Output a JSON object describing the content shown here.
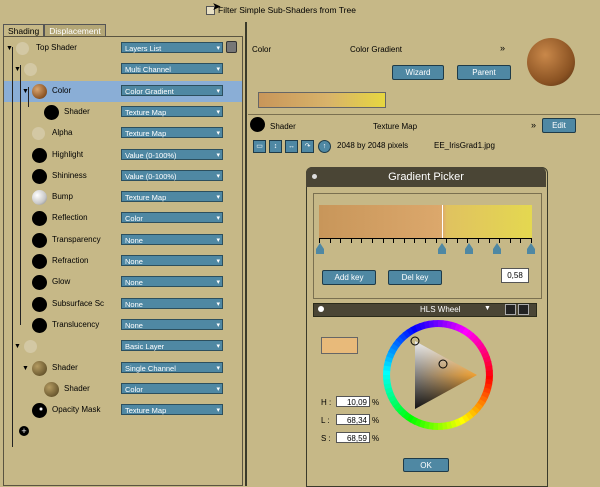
{
  "topbar": {
    "filter_label": "Filter Simple Sub-Shaders from Tree"
  },
  "tabs": [
    {
      "label": "Shading",
      "active": true
    },
    {
      "label": "Displacement",
      "active": false
    }
  ],
  "tree": [
    {
      "label": "Top Shader",
      "value": "Layers List",
      "swatch": "ghost"
    },
    {
      "label": "",
      "value": "Multi Channel",
      "swatch": "ghost"
    },
    {
      "label": "Color",
      "value": "Color Gradient",
      "swatch": "brown",
      "selected": true
    },
    {
      "label": "Shader",
      "value": "Texture Map",
      "swatch": "black"
    },
    {
      "label": "Alpha",
      "value": "Texture Map",
      "swatch": "ghost"
    },
    {
      "label": "Highlight",
      "value": "Value (0-100%)",
      "swatch": "black"
    },
    {
      "label": "Shininess",
      "value": "Value (0-100%)",
      "swatch": "black"
    },
    {
      "label": "Bump",
      "value": "Texture Map",
      "swatch": "white"
    },
    {
      "label": "Reflection",
      "value": "Color",
      "swatch": "black"
    },
    {
      "label": "Transparency",
      "value": "None",
      "swatch": "black"
    },
    {
      "label": "Refraction",
      "value": "None",
      "swatch": "black"
    },
    {
      "label": "Glow",
      "value": "None",
      "swatch": "black"
    },
    {
      "label": "Subsurface Sc",
      "value": "None",
      "swatch": "black"
    },
    {
      "label": "Translucency",
      "value": "None",
      "swatch": "black"
    },
    {
      "label": "",
      "value": "Basic Layer",
      "swatch": "ghost"
    },
    {
      "label": "Shader",
      "value": "Single Channel",
      "swatch": "olive"
    },
    {
      "label": "Shader",
      "value": "Color",
      "swatch": "olive"
    },
    {
      "label": "Opacity Mask",
      "value": "Texture Map",
      "swatch": "speck"
    }
  ],
  "color_panel": {
    "channel_label": "Color",
    "type_label": "Color Gradient",
    "wizard_label": "Wizard",
    "parent_label": "Parent",
    "chevron": "»"
  },
  "shader_panel": {
    "label": "Shader",
    "type_label": "Texture Map",
    "edit_label": "Edit",
    "size_text": "2048 by 2048 pixels",
    "file_name": "EE_IrisGrad1.jpg",
    "icons": [
      "folder-open-icon",
      "flip-vertical-icon",
      "flip-horizontal-icon",
      "rotate-icon",
      "up-arrow-icon"
    ]
  },
  "gradient_picker": {
    "title": "Gradient Picker",
    "add_key_label": "Add key",
    "del_key_label": "Del key",
    "key_position": "0,58",
    "mode_label": "HLS Wheel",
    "h_label": "H :",
    "h_value": "10,09",
    "l_label": "L :",
    "l_value": "68,34",
    "s_label": "S :",
    "s_value": "68,59",
    "percent": "%",
    "ok_label": "OK",
    "current_color": "#e8ba7a"
  }
}
